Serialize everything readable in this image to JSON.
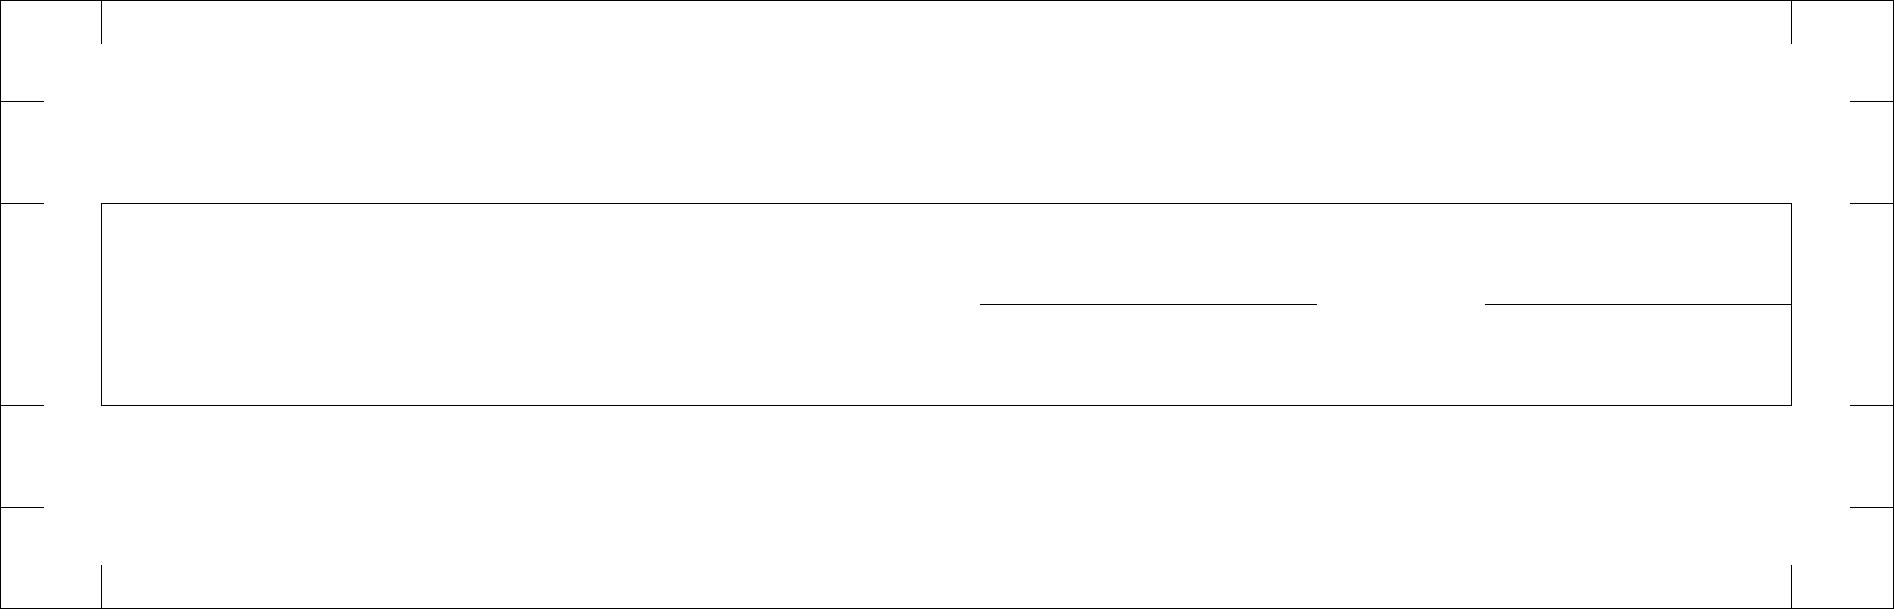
{
  "page": {
    "background": "#ffffff",
    "line_color": "#000000"
  },
  "form": {
    "signature_line_count": 2,
    "text": []
  }
}
